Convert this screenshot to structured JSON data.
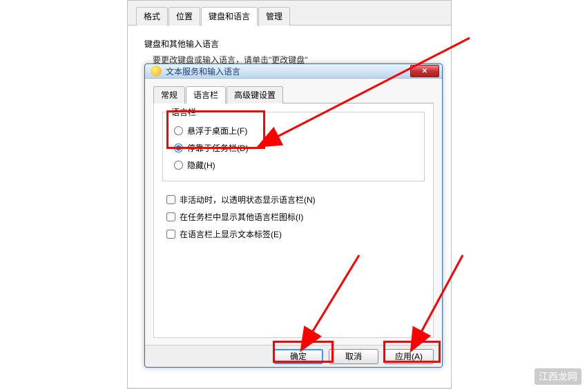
{
  "outer": {
    "tabs": {
      "format": "格式",
      "location": "位置",
      "keyboard_lang": "键盘和语言",
      "admin": "管理"
    },
    "heading": "键盘和其他输入语言",
    "sub_text_prefix": "要更改键盘或输入语言，请单击\"更改键盘\""
  },
  "dialog": {
    "title": "文本服务和输入语言",
    "tabs": {
      "general": "常规",
      "langbar": "语言栏",
      "advanced": "高级键设置"
    },
    "group_title": "语言栏",
    "radios": {
      "float": "悬浮于桌面上(F)",
      "dock": "停靠于任务栏(D)",
      "hidden": "隐藏(H)"
    },
    "checks": {
      "transparent": "非活动时，以透明状态显示语言栏(N)",
      "extra_icons": "在任务栏中显示其他语言栏图标(I)",
      "text_labels": "在语言栏上显示文本标签(E)"
    },
    "buttons": {
      "ok": "确定",
      "cancel": "取消",
      "apply": "应用(A)"
    }
  },
  "watermark": "江西龙网"
}
